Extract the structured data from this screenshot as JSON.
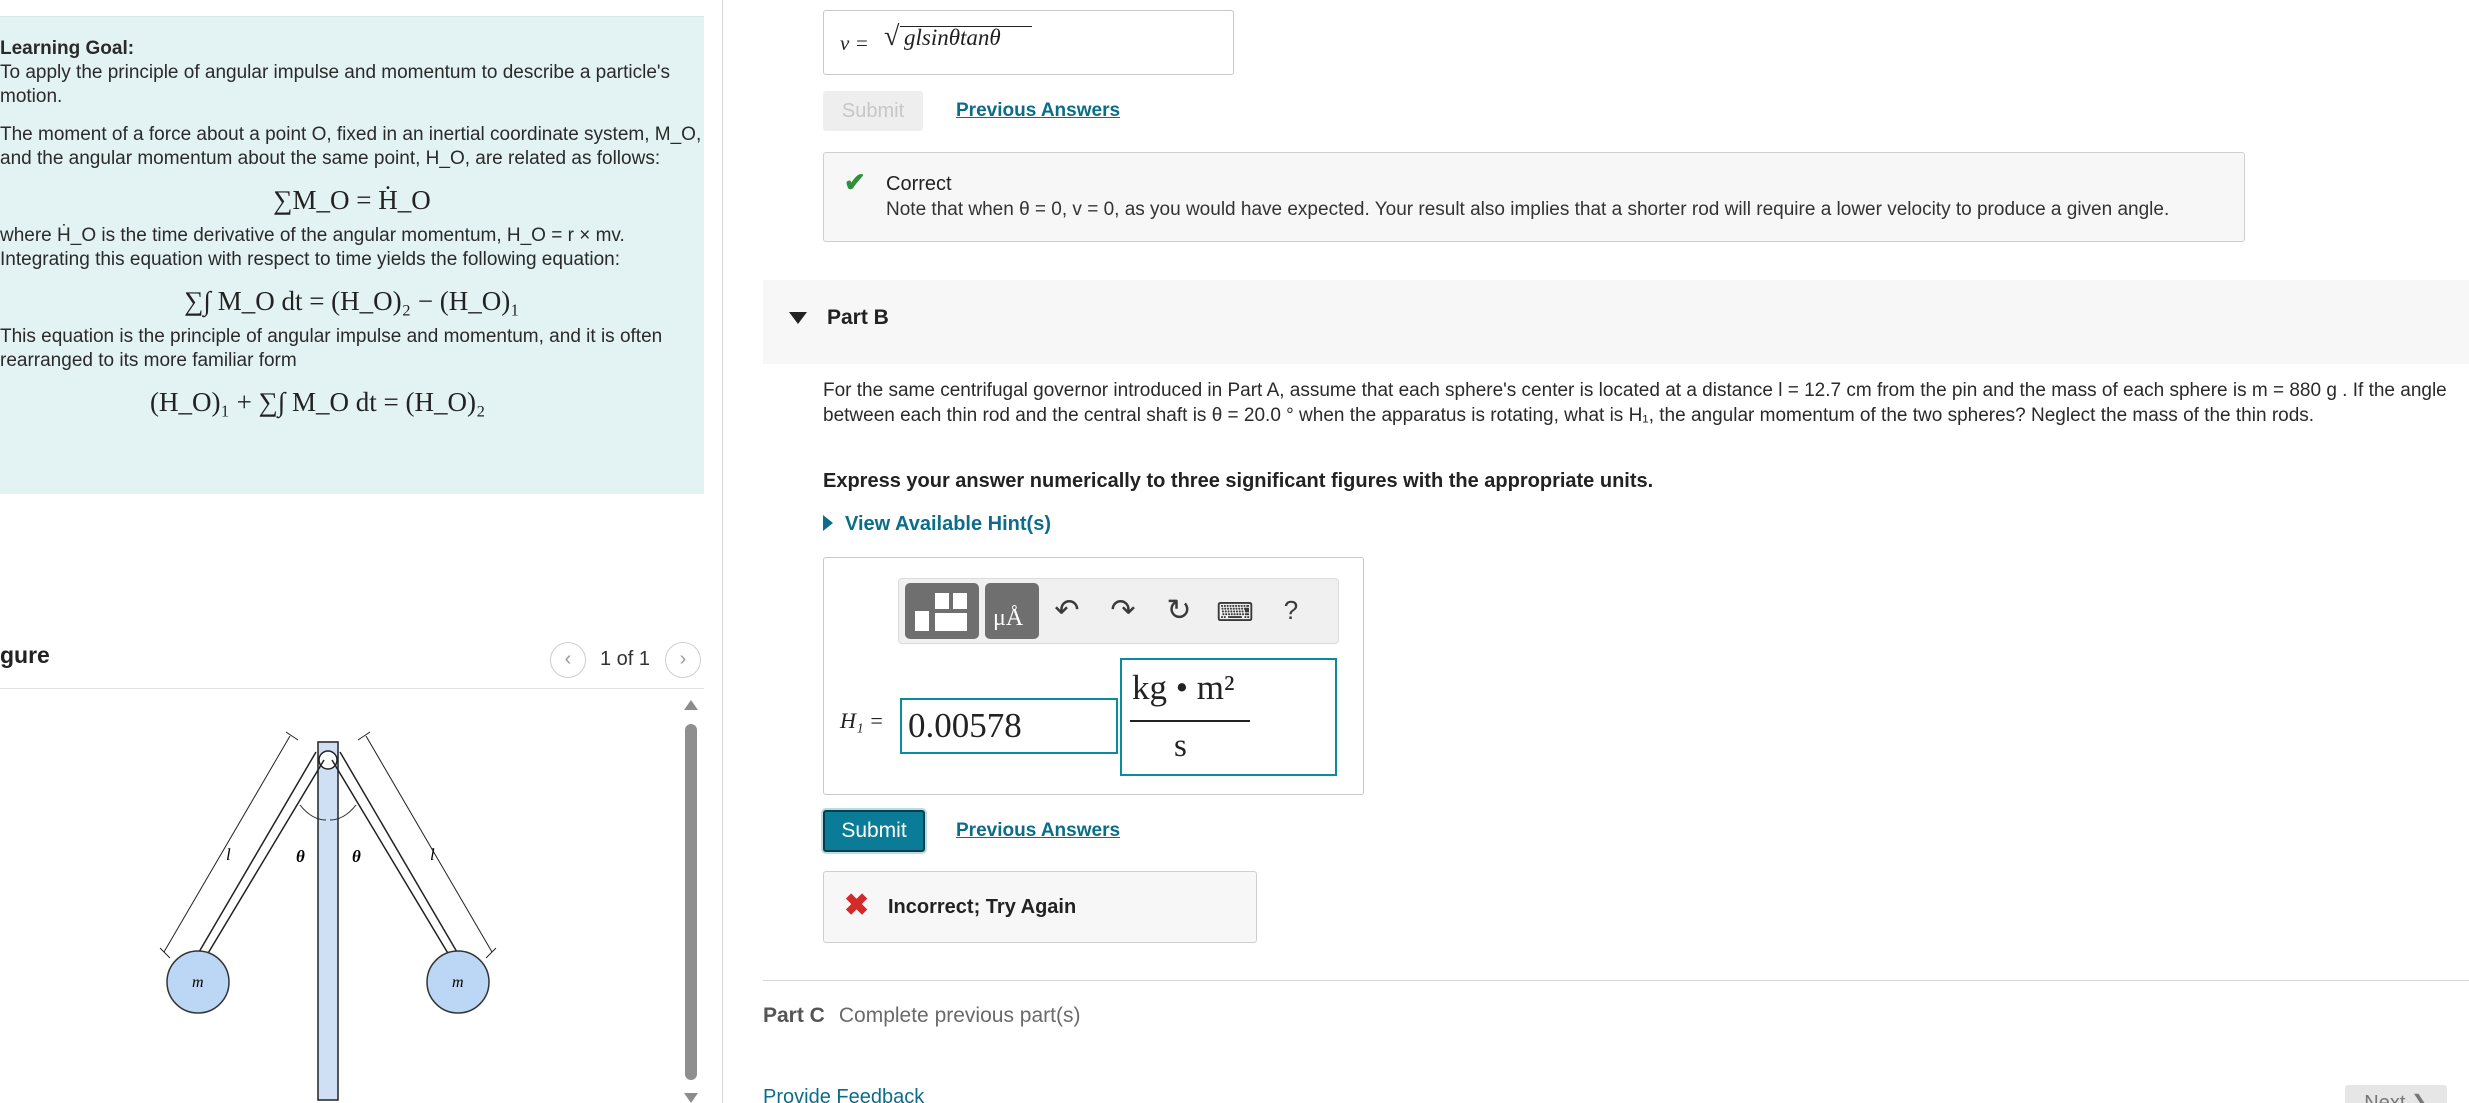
{
  "learning_goal": {
    "title": "Learning Goal:",
    "intro": "To apply the principle of angular impulse and momentum to describe a particle's motion.",
    "para1": "The moment of a force about a point O, fixed in an inertial coordinate system, M_O, and the angular momentum about the same point, H_O, are related as follows:",
    "eq1": "∑M_O = Ḣ_O",
    "para2": "where Ḣ_O is the time derivative of the angular momentum, H_O = r × mv. Integrating this equation with respect to time yields the following equation:",
    "eq2": "∑∫ M_O dt = (H_O)₂ − (H_O)₁",
    "para3": "This equation is the principle of angular impulse and momentum, and it is often rearranged to its more familiar form",
    "eq3": "(H_O)₁ + ∑∫ M_O dt = (H_O)₂"
  },
  "figure": {
    "title": "gure",
    "count": "1 of 1",
    "prev_icon": "chevron-left-icon",
    "next_icon": "chevron-right-icon",
    "labels": {
      "rod_length": "l",
      "angle": "θ",
      "mass": "m"
    }
  },
  "partA": {
    "answer_label": "v =",
    "answer_value": "glsinθtanθ",
    "submit_label": "Submit",
    "previous_answers_label": "Previous Answers",
    "feedback_title": "Correct",
    "feedback_text": "Note that when θ = 0, v = 0, as you would have expected. Your result also implies that a shorter rod will require a lower velocity to produce a given angle."
  },
  "partB": {
    "title": "Part B",
    "text": "For the same centrifugal governor introduced in Part A, assume that each sphere's center is located at a distance l = 12.7 cm from the pin and the mass of each sphere is m = 880 g . If the angle between each thin rod and the central shaft is θ = 20.0 ° when the apparatus is rotating, what is H₁, the angular momentum of the two spheres? Neglect the mass of the thin rods.",
    "instruction": "Express your answer numerically to three significant figures with the appropriate units.",
    "hint_label": "View Available Hint(s)",
    "answer_label": "H₁ =",
    "answer_value": "0.00578",
    "unit_numerator": "kg • m²",
    "unit_denominator": "s",
    "submit_label": "Submit",
    "previous_answers_label": "Previous Answers",
    "feedback_title": "Incorrect; Try Again",
    "toolbar": {
      "help": "?",
      "template_label": "μÅ"
    }
  },
  "partC": {
    "title": "Part C",
    "status": "Complete previous part(s)"
  },
  "footer": {
    "feedback_link": "Provide Feedback",
    "next_label": "Next ❯"
  },
  "colors": {
    "goal_background": "#e3f3f4",
    "accent": "#0b6d8a",
    "correct": "#2f8f3b",
    "incorrect": "#d42a2a",
    "submit_active": "#0b7c97"
  }
}
